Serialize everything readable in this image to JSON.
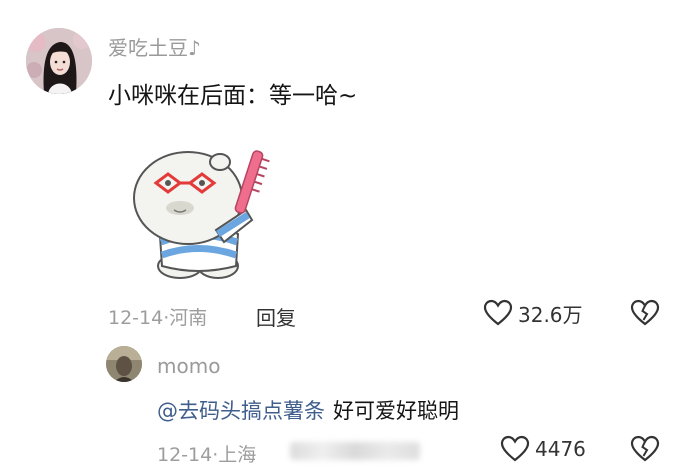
{
  "comment": {
    "username": "爱吃土豆♪",
    "text": "小咪咪在后面：等一哈~",
    "sticker": "sticker-image",
    "date": "12-14",
    "separator": "·",
    "location": "河南",
    "reply_label": "回复",
    "likes": "32.6万",
    "icons": {
      "like": "heart-outline-icon",
      "dislike": "broken-heart-icon"
    }
  },
  "reply": {
    "username": "momo",
    "mention": "@去码头搞点薯条",
    "text": "好可爱好聪明",
    "date": "12-14",
    "separator": "·",
    "location": "上海",
    "likes": "4476",
    "icons": {
      "like": "heart-outline-icon",
      "dislike": "broken-heart-icon"
    }
  },
  "colors": {
    "mention": "#3f5e8c",
    "meta": "#9d9d9d",
    "text": "#151515"
  }
}
